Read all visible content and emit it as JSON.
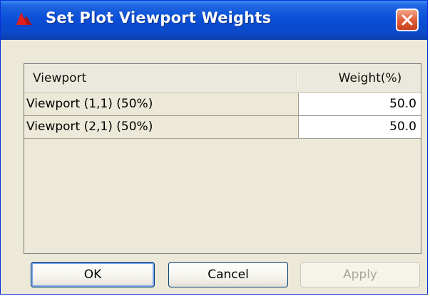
{
  "window": {
    "title": "Set Plot Viewport Weights"
  },
  "table": {
    "columns": [
      "Viewport",
      "Weight(%)"
    ],
    "rows": [
      {
        "viewport": "Viewport (1,1) (50%)",
        "weight": "50.0"
      },
      {
        "viewport": "Viewport (2,1) (50%)",
        "weight": "50.0"
      }
    ]
  },
  "buttons": {
    "ok": "OK",
    "cancel": "Cancel",
    "apply": "Apply"
  },
  "icons": {
    "app": "red-peak-app-icon",
    "close": "close-icon"
  },
  "colors": {
    "titlebar": "#0a4fd8",
    "close": "#e2603a",
    "dialog_bg": "#ece9d8"
  }
}
